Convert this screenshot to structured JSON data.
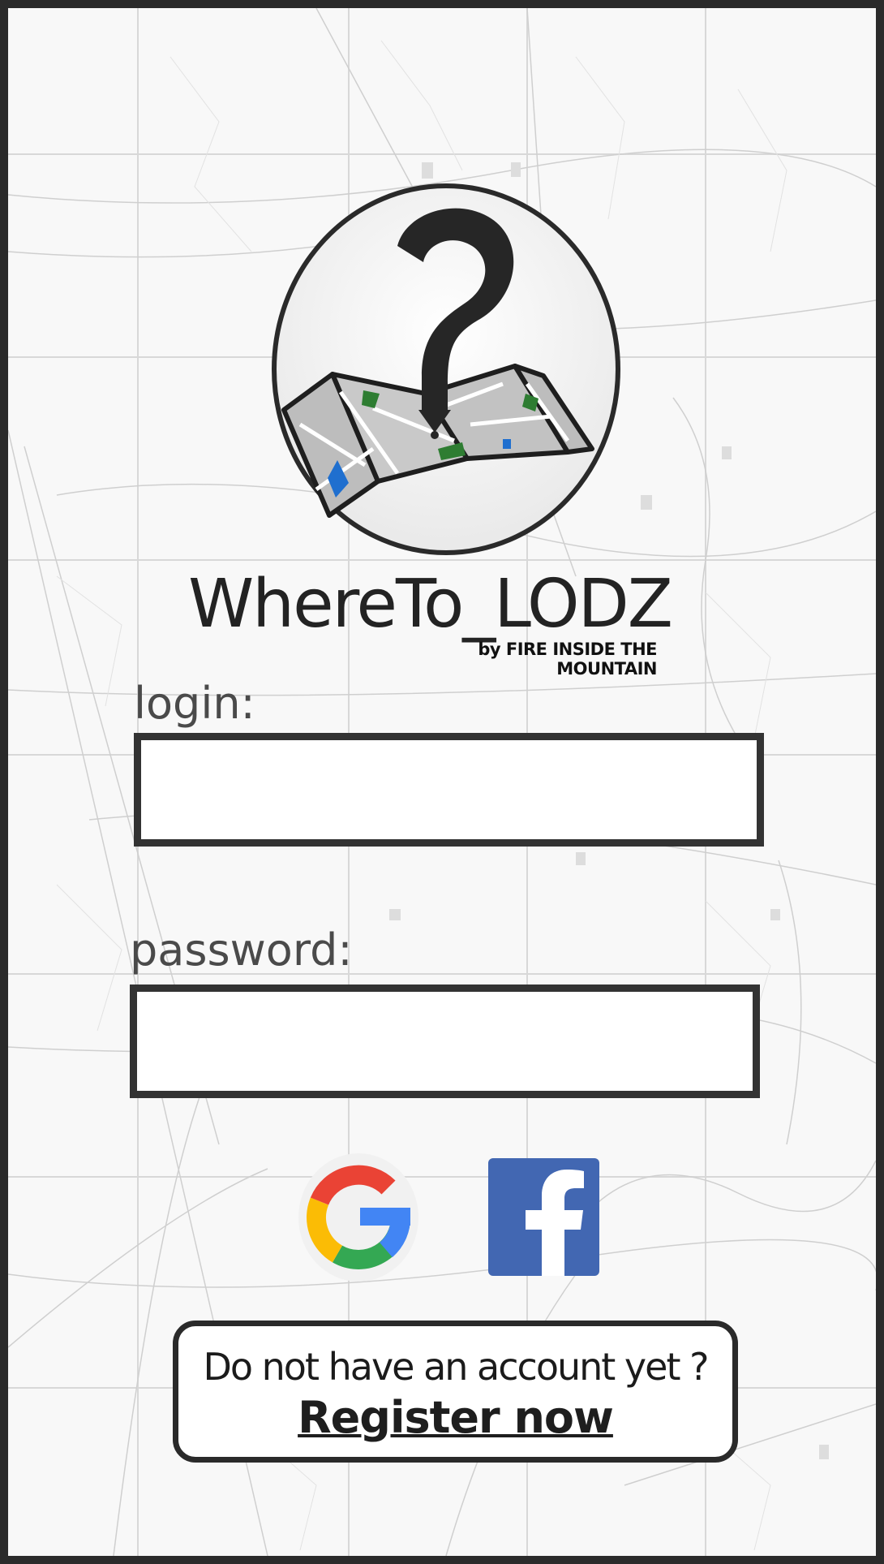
{
  "app": {
    "title": "WhereTo_LODZ",
    "subtitle": "by FIRE INSIDE THE MOUNTAIN"
  },
  "login": {
    "label": "login:",
    "value": ""
  },
  "password": {
    "label": "password:",
    "value": ""
  },
  "social": {
    "google_icon": "google-g-icon",
    "facebook_icon": "facebook-f-icon"
  },
  "register": {
    "prompt": "Do not have an account yet ?",
    "link_label": "Register now"
  },
  "colors": {
    "frame": "#2b2b2b",
    "field_border": "#333333",
    "facebook_blue": "#4267b2",
    "google_red": "#ea4335",
    "google_yellow": "#fbbc05",
    "google_green": "#34a853",
    "google_blue": "#4285f4"
  }
}
